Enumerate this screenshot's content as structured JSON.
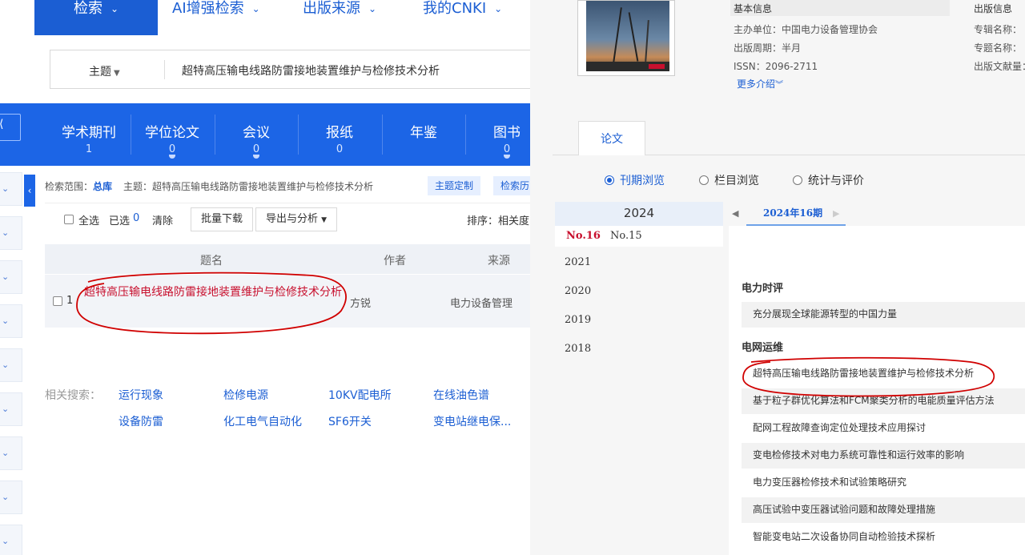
{
  "left": {
    "nav": [
      {
        "label": "检索",
        "active": true
      },
      {
        "label": "AI增强检索",
        "active": false
      },
      {
        "label": "出版来源",
        "active": false
      },
      {
        "label": "我的CNKI",
        "active": false
      }
    ],
    "search": {
      "field": "主题",
      "query": "超特高压输电线路防雷接地装置维护与检修技术分析"
    },
    "categories": [
      {
        "name": "学术期刊",
        "count": "1"
      },
      {
        "name": "学位论文",
        "count": "0"
      },
      {
        "name": "会议",
        "count": "0"
      },
      {
        "name": "报纸",
        "count": "0"
      },
      {
        "name": "年鉴",
        "count": ""
      },
      {
        "name": "图书",
        "count": "0"
      }
    ],
    "scope": {
      "label": "检索范围：",
      "db": "总库",
      "topic": "主题：超特高压输电线路防雷接地装置维护与检修技术分析",
      "btn_custom": "主题定制",
      "btn_history": "检索历"
    },
    "toolbar": {
      "select_all": "全选",
      "selected": "已选",
      "selected_count": "0",
      "clear": "清除",
      "batch_download": "批量下载",
      "export": "导出与分析",
      "sort": "排序：相关度"
    },
    "table": {
      "headers": {
        "title": "题名",
        "author": "作者",
        "source": "来源"
      },
      "rows": [
        {
          "num": "1",
          "title": "超特高压输电线路防雷接地装置维护与检修技术分析",
          "author": "方锐",
          "source": "电力设备管理"
        }
      ]
    },
    "related": {
      "label": "相关搜索：",
      "keywords": [
        "运行现象",
        "检修电源",
        "10KV配电所",
        "在线油色谱",
        "设备防雷",
        "化工电气自动化",
        "SF6开关",
        "变电站继电保..."
      ]
    }
  },
  "right": {
    "basic_info": {
      "heading": "基本信息",
      "sponsor": "主办单位：中国电力设备管理协会",
      "cycle": "出版周期：半月",
      "issn": "ISSN：2096-2711",
      "more": "更多介绍"
    },
    "pub_info": {
      "heading": "出版信息",
      "series": "专辑名称：",
      "topic": "专题名称：",
      "count": "出版文献量："
    },
    "tab": "论文",
    "radios": [
      {
        "label": "刊期浏览",
        "checked": true
      },
      {
        "label": "栏目浏览",
        "checked": false
      },
      {
        "label": "统计与评价",
        "checked": false
      }
    ],
    "year_current": "2024",
    "issues": [
      {
        "label": "No.16",
        "current": true
      },
      {
        "label": "No.15",
        "current": false
      }
    ],
    "years": [
      "2021",
      "2020",
      "2019",
      "2018"
    ],
    "issue_nav": {
      "prev": "◀",
      "current": "2024年16期",
      "next": "▶"
    },
    "sections": [
      {
        "name": "电力时评",
        "articles": [
          "充分展现全球能源转型的中国力量"
        ]
      },
      {
        "name": "电网运维",
        "articles": [
          "超特高压输电线路防雷接地装置维护与检修技术分析",
          "基于粒子群优化算法和FCM聚类分析的电能质量评估方法",
          "配网工程故障查询定位处理技术应用探讨",
          "变电检修技术对电力系统可靠性和运行效率的影响",
          "电力变压器检修技术和试验策略研究",
          "高压试验中变压器试验问题和故障处理措施",
          "智能变电站二次设备协同自动检验技术探析"
        ]
      }
    ]
  },
  "colors": {
    "brand_blue": "#1b5ed3",
    "category_bar": "#1c65e6",
    "highlight_red": "#c8102e",
    "annotation_red": "#d00000"
  }
}
